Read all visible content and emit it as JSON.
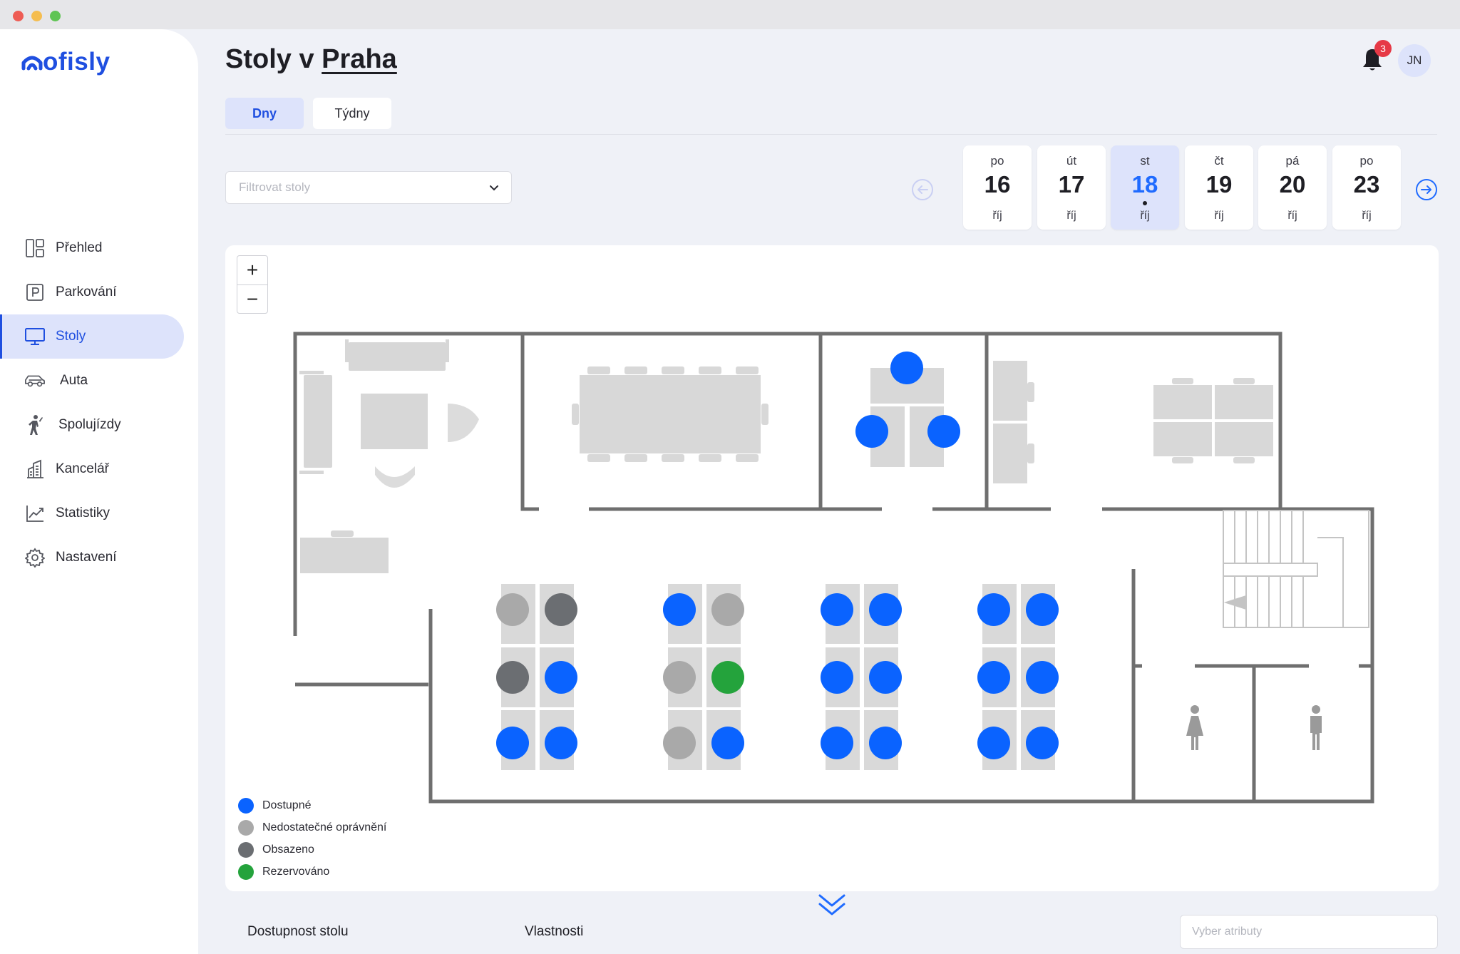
{
  "app": {
    "logo_text": "ofisly",
    "brand_color": "#1f4fe0"
  },
  "sidebar": {
    "items": [
      {
        "label": "Přehled",
        "icon": "dashboard-icon"
      },
      {
        "label": "Parkování",
        "icon": "parking-icon"
      },
      {
        "label": "Stoly",
        "icon": "monitor-icon",
        "active": true
      },
      {
        "label": "Auta",
        "icon": "car-icon"
      },
      {
        "label": "Spolujízdy",
        "icon": "hitchhiker-icon"
      },
      {
        "label": "Kancelář",
        "icon": "building-icon"
      },
      {
        "label": "Statistiky",
        "icon": "chart-line-icon"
      },
      {
        "label": "Nastavení",
        "icon": "gear-icon"
      }
    ]
  },
  "header": {
    "title_prefix": "Stoly v",
    "title_city": "Praha",
    "notifications_count": "3",
    "user_initials": "JN"
  },
  "view_toggle": {
    "days_label": "Dny",
    "weeks_label": "Týdny",
    "selected": "Dny"
  },
  "filter": {
    "placeholder": "Filtrovat stoly"
  },
  "days": [
    {
      "weekday": "po",
      "day": "16",
      "month": "říj"
    },
    {
      "weekday": "út",
      "day": "17",
      "month": "říj"
    },
    {
      "weekday": "st",
      "day": "18",
      "month": "říj",
      "selected": true,
      "today": true
    },
    {
      "weekday": "čt",
      "day": "19",
      "month": "říj"
    },
    {
      "weekday": "pá",
      "day": "20",
      "month": "říj"
    },
    {
      "weekday": "po",
      "day": "23",
      "month": "říj"
    }
  ],
  "map": {
    "zoom_in": "+",
    "zoom_out": "−",
    "status_colors": {
      "available": "#0a63ff",
      "no_permission": "#a9a9a9",
      "occupied": "#6b6e72",
      "reserved": "#24a33c"
    },
    "legend": [
      {
        "label": "Dostupné",
        "status": "available",
        "color": "#0a63ff"
      },
      {
        "label": "Nedostatečné oprávnění",
        "status": "no_permission",
        "color": "#a9a9a9"
      },
      {
        "label": "Obsazeno",
        "status": "occupied",
        "color": "#6b6e72"
      },
      {
        "label": "Rezervováno",
        "status": "reserved",
        "color": "#24a33c"
      }
    ],
    "meeting_room_seats": [
      "available",
      "available",
      "available"
    ],
    "desk_clusters": [
      [
        "no_permission",
        "occupied",
        "occupied",
        "available",
        "available",
        "available"
      ],
      [
        "available",
        "no_permission",
        "no_permission",
        "reserved",
        "no_permission",
        "available"
      ],
      [
        "available",
        "available",
        "available",
        "available",
        "available",
        "available"
      ],
      [
        "available",
        "available",
        "available",
        "available",
        "available",
        "available"
      ]
    ]
  },
  "bottom": {
    "availability_label": "Dostupnost stolu",
    "properties_label": "Vlastnosti",
    "attributes_placeholder": "Vyber atributy"
  }
}
